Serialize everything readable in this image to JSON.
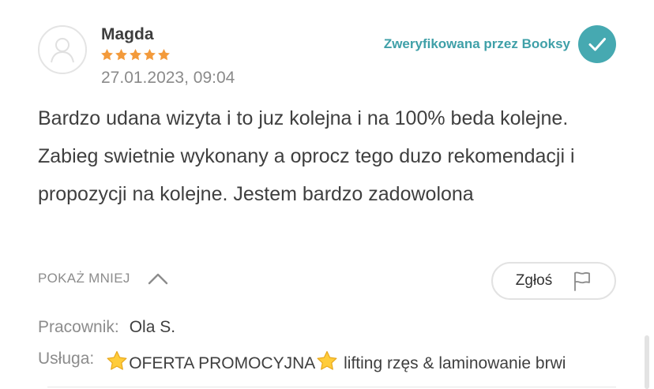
{
  "review": {
    "author": "Magda",
    "rating": 5,
    "date": "27.01.2023, 09:04",
    "verified_label": "Zweryfikowana przez Booksy",
    "text": "Bardzo udana wizyta i to juz kolejna i na 100% beda kolejne. Zabieg swietnie wykonany a oprocz tego duzo rekomendacji i propozycji na kolejne. Jestem bardzo zadowolona",
    "show_less_label": "POKAŻ MNIEJ",
    "report_label": "Zgłoś",
    "employee_label": "Pracownik:",
    "employee_value": "Ola S.",
    "service_label": "Usługa:",
    "service_part1": "OFERTA PROMOCYJNA",
    "service_part2": " lifting rzęs & laminowanie brwi"
  },
  "icons": {
    "avatar": "user-placeholder-icon",
    "star": "star-icon",
    "verified": "checkmark-icon",
    "chevron": "chevron-up-icon",
    "report": "flag-icon",
    "emoji": "star-emoji-icon"
  },
  "colors": {
    "star": "#f39a3b",
    "verified_text": "#3fa0a8",
    "verified_badge": "#46a9b1",
    "muted_text": "#8c8c8c"
  }
}
